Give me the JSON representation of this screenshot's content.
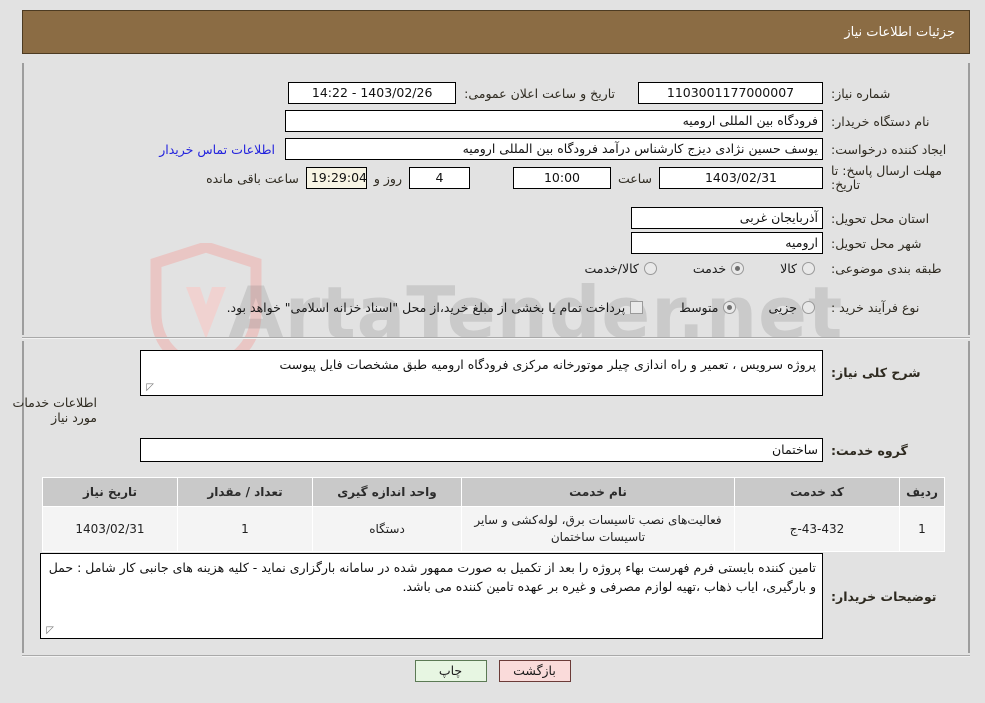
{
  "header": {
    "title": "جزئیات اطلاعات نیاز",
    "bg_color": "#8b6c44",
    "text_color": "#ffffff"
  },
  "watermark": {
    "text": "ArtaTender.net",
    "shield_color": "#e8c4c2"
  },
  "form": {
    "need_number_label": "شماره نیاز:",
    "need_number_value": "1103001177000007",
    "announce_label": "تاریخ و ساعت اعلان عمومی:",
    "announce_value": "14:22 - 1403/02/26",
    "buyer_org_label": "نام دستگاه خریدار:",
    "buyer_org_value": "فرودگاه بین المللی ارومیه",
    "creator_label": "ایجاد کننده درخواست:",
    "creator_value": "یوسف حسین نژادی دیزج کارشناس درآمد فرودگاه بین المللی ارومیه",
    "contact_link": "اطلاعات تماس خریدار",
    "deadline_label": "مهلت ارسال پاسخ: تا تاریخ:",
    "deadline_date": "1403/02/31",
    "deadline_hour_label": "ساعت",
    "deadline_hour_value": "10:00",
    "remaining_days": "4",
    "remaining_days_label": "روز و",
    "remaining_time": "19:29:04",
    "remaining_suffix_label": "ساعت باقی مانده",
    "province_label": "استان محل تحویل:",
    "province_value": "آذربایجان غربی",
    "city_label": "شهر محل تحویل:",
    "city_value": "ارومیه",
    "category_label": "طبقه بندی موضوعی:",
    "category_options": [
      {
        "label": "کالا",
        "selected": false
      },
      {
        "label": "خدمت",
        "selected": true
      },
      {
        "label": "کالا/خدمت",
        "selected": false
      }
    ],
    "process_label": "نوع فرآیند خرید :",
    "process_options": [
      {
        "label": "جزیی",
        "selected": true
      },
      {
        "label": "متوسط",
        "selected": false
      }
    ],
    "treasury_checkbox_checked": false,
    "treasury_checkbox_label": "پرداخت تمام یا بخشی از مبلغ خرید،از محل \"اسناد خزانه اسلامی\" خواهد بود.",
    "description_label": "شرح کلی نیاز:",
    "description_value": "پروژه سرویس ، تعمیر و راه اندازی چیلر موتورخانه مرکزی فرودگاه ارومیه طبق مشخصات فایل پیوست",
    "services_section_title": "اطلاعات خدمات مورد نیاز",
    "service_group_label": "گروه خدمت:",
    "service_group_value": "ساختمان",
    "buyer_notes_label": "توضیحات خریدار:",
    "buyer_notes_value": "تامین کننده بایستی فرم فهرست بهاء پروژه را بعد از تکمیل به صورت ممهور شده در سامانه بارگزاری نماید - کلیه هزینه های جانبی کار شامل : حمل و بارگیری، ایاب ذهاب ،تهیه لوازم مصرفی و غیره بر عهده تامین کننده می باشد."
  },
  "table": {
    "headers": [
      "ردیف",
      "کد خدمت",
      "نام خدمت",
      "واحد اندازه گیری",
      "تعداد / مقدار",
      "تاریخ نیاز"
    ],
    "rows": [
      {
        "index": "1",
        "service_code": "ج-43-432",
        "service_name": "فعالیت‌های نصب تاسیسات برق، لوله‌کشی و سایر تاسیسات ساختمان",
        "unit": "دستگاه",
        "quantity": "1",
        "need_date": "1403/02/31"
      }
    ]
  },
  "buttons": {
    "print": "چاپ",
    "back": "بازگشت"
  }
}
